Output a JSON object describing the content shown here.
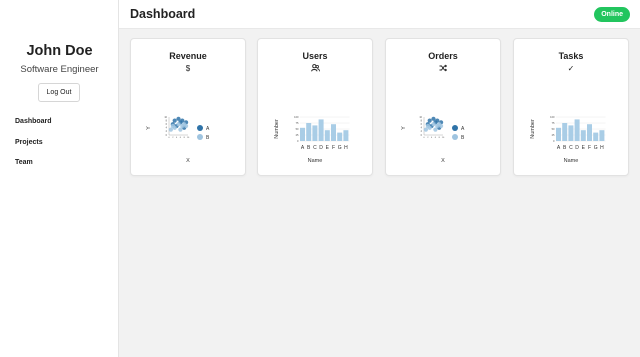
{
  "sidebar": {
    "user_name": "John Doe",
    "user_role": "Software Engineer",
    "logout_label": "Log Out",
    "nav": [
      {
        "label": "Dashboard",
        "active": true
      },
      {
        "label": "Projects",
        "active": false
      },
      {
        "label": "Team",
        "active": false
      }
    ]
  },
  "header": {
    "title": "Dashboard",
    "status": "Online",
    "status_color": "#22c55e"
  },
  "cards": [
    {
      "title": "Revenue",
      "icon": "dollar-icon",
      "icon_glyph": "$",
      "chart_type": "scatter",
      "xlabel": "X",
      "ylabel": "Y"
    },
    {
      "title": "Users",
      "icon": "users-icon",
      "icon_glyph": "",
      "chart_type": "bar",
      "xlabel": "Name",
      "ylabel": "Number"
    },
    {
      "title": "Orders",
      "icon": "shuffle-icon",
      "icon_glyph": "",
      "chart_type": "scatter",
      "xlabel": "X",
      "ylabel": "Y"
    },
    {
      "title": "Tasks",
      "icon": "check-icon",
      "icon_glyph": "✓",
      "chart_type": "bar",
      "xlabel": "Name",
      "ylabel": "Number"
    }
  ],
  "chart_data": [
    {
      "type": "scatter",
      "xlabel": "X",
      "ylabel": "Y",
      "series": [
        {
          "name": "A",
          "color": "#2f73a8",
          "points": [
            [
              2,
              6
            ],
            [
              3,
              8
            ],
            [
              4,
              5
            ],
            [
              5,
              9
            ],
            [
              6,
              7
            ],
            [
              7,
              8
            ],
            [
              8,
              4
            ],
            [
              9,
              7
            ]
          ]
        },
        {
          "name": "B",
          "color": "#9fc4e0",
          "points": [
            [
              1,
              3
            ],
            [
              2,
              5
            ],
            [
              3,
              4
            ],
            [
              5,
              6
            ],
            [
              6,
              3
            ],
            [
              7,
              5
            ],
            [
              8,
              6
            ],
            [
              9,
              5
            ]
          ]
        }
      ]
    },
    {
      "type": "bar",
      "xlabel": "Name",
      "ylabel": "Number",
      "categories": [
        "A",
        "B",
        "C",
        "D",
        "E",
        "F",
        "G",
        "H"
      ],
      "values": [
        55,
        75,
        65,
        90,
        45,
        70,
        35,
        45
      ],
      "color": "#a9cde6"
    },
    {
      "type": "scatter",
      "xlabel": "X",
      "ylabel": "Y",
      "series": [
        {
          "name": "A",
          "color": "#2f73a8",
          "points": [
            [
              2,
              6
            ],
            [
              3,
              8
            ],
            [
              4,
              5
            ],
            [
              5,
              9
            ],
            [
              6,
              7
            ],
            [
              7,
              8
            ],
            [
              8,
              4
            ],
            [
              9,
              7
            ]
          ]
        },
        {
          "name": "B",
          "color": "#9fc4e0",
          "points": [
            [
              1,
              3
            ],
            [
              2,
              5
            ],
            [
              3,
              4
            ],
            [
              5,
              6
            ],
            [
              6,
              3
            ],
            [
              7,
              5
            ],
            [
              8,
              6
            ],
            [
              9,
              5
            ]
          ]
        }
      ]
    },
    {
      "type": "bar",
      "xlabel": "Name",
      "ylabel": "Number",
      "categories": [
        "A",
        "B",
        "C",
        "D",
        "E",
        "F",
        "G",
        "H"
      ],
      "values": [
        55,
        75,
        65,
        90,
        45,
        70,
        35,
        45
      ],
      "color": "#a9cde6"
    }
  ]
}
